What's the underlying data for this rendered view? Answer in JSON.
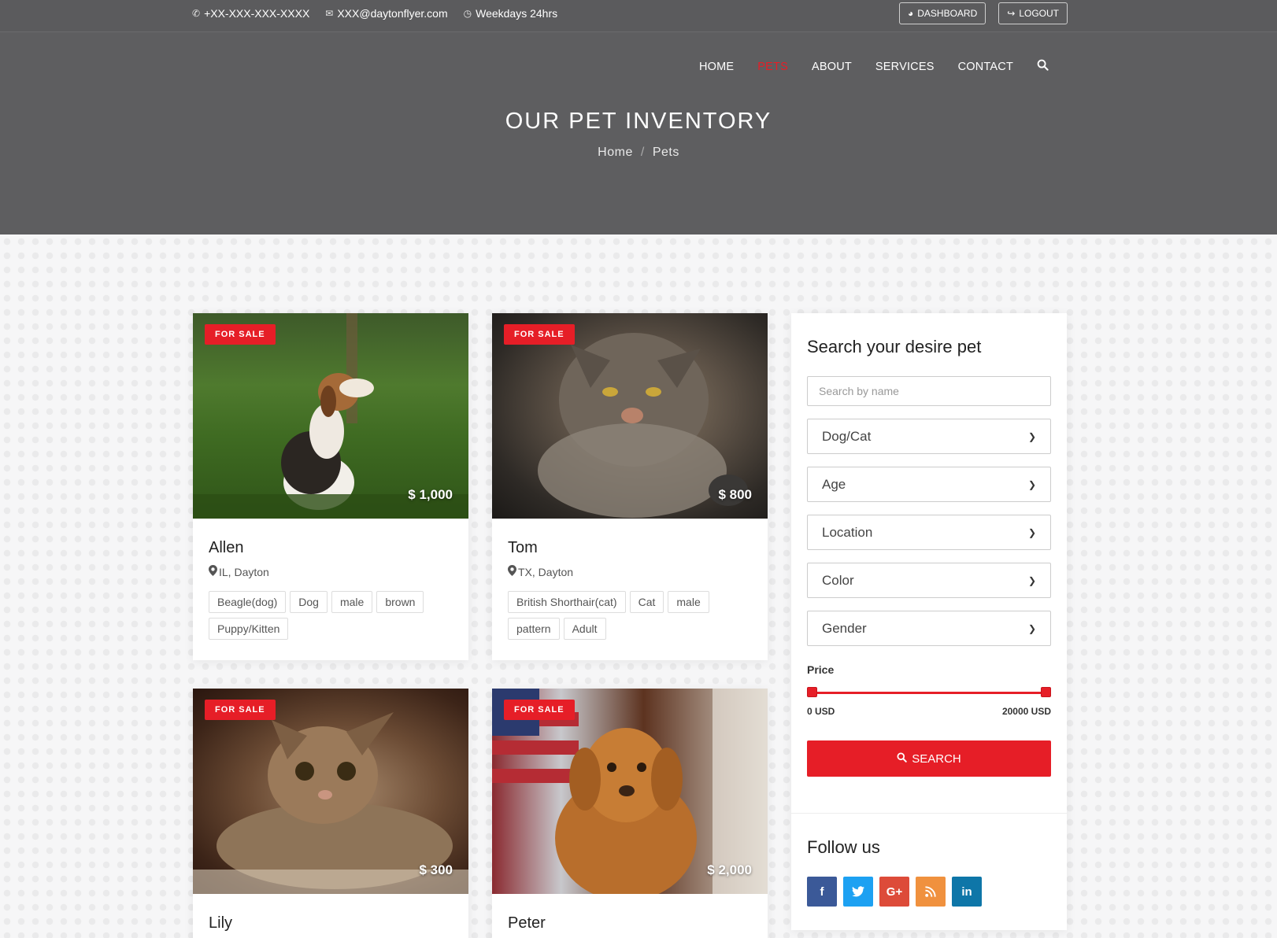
{
  "topbar": {
    "phone": "+XX-XXX-XXX-XXXX",
    "email": "XXX@daytonflyer.com",
    "hours": "Weekdays 24hrs",
    "dashboard_label": "DASHBOARD",
    "logout_label": "LOGOUT"
  },
  "nav": {
    "items": [
      {
        "label": "HOME"
      },
      {
        "label": "PETS"
      },
      {
        "label": "ABOUT"
      },
      {
        "label": "SERVICES"
      },
      {
        "label": "CONTACT"
      }
    ],
    "active": "PETS"
  },
  "hero": {
    "title": "OUR PET INVENTORY",
    "breadcrumb": [
      "Home",
      "Pets"
    ]
  },
  "pets": [
    {
      "badge": "FOR SALE",
      "price": "$ 1,000",
      "name": "Allen",
      "location": "IL, Dayton",
      "tags": [
        "Beagle(dog)",
        "Dog",
        "male",
        "brown",
        "Puppy/Kitten"
      ]
    },
    {
      "badge": "FOR SALE",
      "price": "$ 800",
      "name": "Tom",
      "location": "TX, Dayton",
      "tags": [
        "British Shorthair(cat)",
        "Cat",
        "male",
        "pattern",
        "Adult"
      ]
    },
    {
      "badge": "FOR SALE",
      "price": "$ 300",
      "name": "Lily"
    },
    {
      "badge": "FOR SALE",
      "price": "$ 2,000",
      "name": "Peter"
    }
  ],
  "sidebar": {
    "title": "Search your desire pet",
    "search_placeholder": "Search by name",
    "selects": [
      "Dog/Cat",
      "Age",
      "Location",
      "Color",
      "Gender"
    ],
    "price_label": "Price",
    "price_min": "0 USD",
    "price_max": "20000 USD",
    "price_range": [
      0,
      20000
    ],
    "search_button": "SEARCH",
    "follow_title": "Follow us",
    "socials": [
      "facebook",
      "twitter",
      "google-plus",
      "rss",
      "linkedin"
    ]
  },
  "colors": {
    "accent": "#e61e27",
    "header_bg": "#5e5e60",
    "facebook": "#3b5998",
    "twitter": "#1da1f2",
    "google": "#dd4b39",
    "rss": "#f0913e",
    "linkedin": "#0e76a8"
  }
}
